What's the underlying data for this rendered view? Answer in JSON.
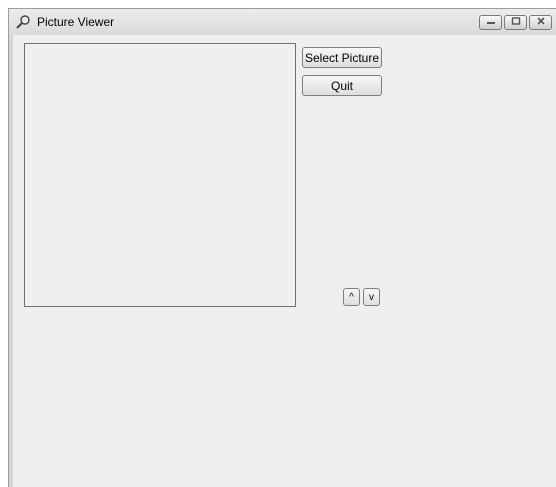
{
  "window": {
    "title": "Picture Viewer",
    "icons": {
      "app": "magnifier-icon",
      "minimize": "minimize-icon",
      "maximize": "maximize-icon",
      "close": "close-icon"
    }
  },
  "buttons": {
    "select_picture": "Select Picture",
    "quit": "Quit",
    "up": "^",
    "down": "v"
  }
}
